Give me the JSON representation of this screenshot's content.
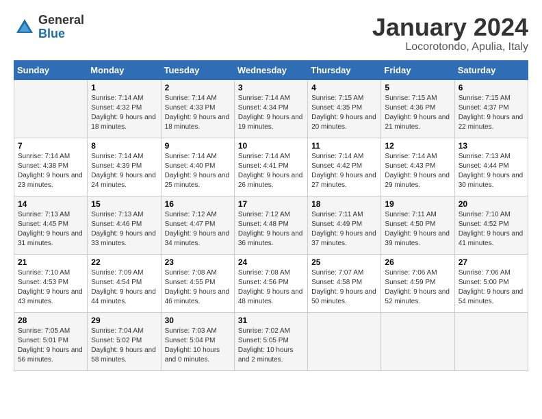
{
  "header": {
    "logo_general": "General",
    "logo_blue": "Blue",
    "month_title": "January 2024",
    "location": "Locorotondo, Apulia, Italy"
  },
  "calendar": {
    "days_of_week": [
      "Sunday",
      "Monday",
      "Tuesday",
      "Wednesday",
      "Thursday",
      "Friday",
      "Saturday"
    ],
    "weeks": [
      [
        {
          "day": "",
          "sunrise": "",
          "sunset": "",
          "daylight": ""
        },
        {
          "day": "1",
          "sunrise": "Sunrise: 7:14 AM",
          "sunset": "Sunset: 4:32 PM",
          "daylight": "Daylight: 9 hours and 18 minutes."
        },
        {
          "day": "2",
          "sunrise": "Sunrise: 7:14 AM",
          "sunset": "Sunset: 4:33 PM",
          "daylight": "Daylight: 9 hours and 18 minutes."
        },
        {
          "day": "3",
          "sunrise": "Sunrise: 7:14 AM",
          "sunset": "Sunset: 4:34 PM",
          "daylight": "Daylight: 9 hours and 19 minutes."
        },
        {
          "day": "4",
          "sunrise": "Sunrise: 7:15 AM",
          "sunset": "Sunset: 4:35 PM",
          "daylight": "Daylight: 9 hours and 20 minutes."
        },
        {
          "day": "5",
          "sunrise": "Sunrise: 7:15 AM",
          "sunset": "Sunset: 4:36 PM",
          "daylight": "Daylight: 9 hours and 21 minutes."
        },
        {
          "day": "6",
          "sunrise": "Sunrise: 7:15 AM",
          "sunset": "Sunset: 4:37 PM",
          "daylight": "Daylight: 9 hours and 22 minutes."
        }
      ],
      [
        {
          "day": "7",
          "sunrise": "Sunrise: 7:14 AM",
          "sunset": "Sunset: 4:38 PM",
          "daylight": "Daylight: 9 hours and 23 minutes."
        },
        {
          "day": "8",
          "sunrise": "Sunrise: 7:14 AM",
          "sunset": "Sunset: 4:39 PM",
          "daylight": "Daylight: 9 hours and 24 minutes."
        },
        {
          "day": "9",
          "sunrise": "Sunrise: 7:14 AM",
          "sunset": "Sunset: 4:40 PM",
          "daylight": "Daylight: 9 hours and 25 minutes."
        },
        {
          "day": "10",
          "sunrise": "Sunrise: 7:14 AM",
          "sunset": "Sunset: 4:41 PM",
          "daylight": "Daylight: 9 hours and 26 minutes."
        },
        {
          "day": "11",
          "sunrise": "Sunrise: 7:14 AM",
          "sunset": "Sunset: 4:42 PM",
          "daylight": "Daylight: 9 hours and 27 minutes."
        },
        {
          "day": "12",
          "sunrise": "Sunrise: 7:14 AM",
          "sunset": "Sunset: 4:43 PM",
          "daylight": "Daylight: 9 hours and 29 minutes."
        },
        {
          "day": "13",
          "sunrise": "Sunrise: 7:13 AM",
          "sunset": "Sunset: 4:44 PM",
          "daylight": "Daylight: 9 hours and 30 minutes."
        }
      ],
      [
        {
          "day": "14",
          "sunrise": "Sunrise: 7:13 AM",
          "sunset": "Sunset: 4:45 PM",
          "daylight": "Daylight: 9 hours and 31 minutes."
        },
        {
          "day": "15",
          "sunrise": "Sunrise: 7:13 AM",
          "sunset": "Sunset: 4:46 PM",
          "daylight": "Daylight: 9 hours and 33 minutes."
        },
        {
          "day": "16",
          "sunrise": "Sunrise: 7:12 AM",
          "sunset": "Sunset: 4:47 PM",
          "daylight": "Daylight: 9 hours and 34 minutes."
        },
        {
          "day": "17",
          "sunrise": "Sunrise: 7:12 AM",
          "sunset": "Sunset: 4:48 PM",
          "daylight": "Daylight: 9 hours and 36 minutes."
        },
        {
          "day": "18",
          "sunrise": "Sunrise: 7:11 AM",
          "sunset": "Sunset: 4:49 PM",
          "daylight": "Daylight: 9 hours and 37 minutes."
        },
        {
          "day": "19",
          "sunrise": "Sunrise: 7:11 AM",
          "sunset": "Sunset: 4:50 PM",
          "daylight": "Daylight: 9 hours and 39 minutes."
        },
        {
          "day": "20",
          "sunrise": "Sunrise: 7:10 AM",
          "sunset": "Sunset: 4:52 PM",
          "daylight": "Daylight: 9 hours and 41 minutes."
        }
      ],
      [
        {
          "day": "21",
          "sunrise": "Sunrise: 7:10 AM",
          "sunset": "Sunset: 4:53 PM",
          "daylight": "Daylight: 9 hours and 43 minutes."
        },
        {
          "day": "22",
          "sunrise": "Sunrise: 7:09 AM",
          "sunset": "Sunset: 4:54 PM",
          "daylight": "Daylight: 9 hours and 44 minutes."
        },
        {
          "day": "23",
          "sunrise": "Sunrise: 7:08 AM",
          "sunset": "Sunset: 4:55 PM",
          "daylight": "Daylight: 9 hours and 46 minutes."
        },
        {
          "day": "24",
          "sunrise": "Sunrise: 7:08 AM",
          "sunset": "Sunset: 4:56 PM",
          "daylight": "Daylight: 9 hours and 48 minutes."
        },
        {
          "day": "25",
          "sunrise": "Sunrise: 7:07 AM",
          "sunset": "Sunset: 4:58 PM",
          "daylight": "Daylight: 9 hours and 50 minutes."
        },
        {
          "day": "26",
          "sunrise": "Sunrise: 7:06 AM",
          "sunset": "Sunset: 4:59 PM",
          "daylight": "Daylight: 9 hours and 52 minutes."
        },
        {
          "day": "27",
          "sunrise": "Sunrise: 7:06 AM",
          "sunset": "Sunset: 5:00 PM",
          "daylight": "Daylight: 9 hours and 54 minutes."
        }
      ],
      [
        {
          "day": "28",
          "sunrise": "Sunrise: 7:05 AM",
          "sunset": "Sunset: 5:01 PM",
          "daylight": "Daylight: 9 hours and 56 minutes."
        },
        {
          "day": "29",
          "sunrise": "Sunrise: 7:04 AM",
          "sunset": "Sunset: 5:02 PM",
          "daylight": "Daylight: 9 hours and 58 minutes."
        },
        {
          "day": "30",
          "sunrise": "Sunrise: 7:03 AM",
          "sunset": "Sunset: 5:04 PM",
          "daylight": "Daylight: 10 hours and 0 minutes."
        },
        {
          "day": "31",
          "sunrise": "Sunrise: 7:02 AM",
          "sunset": "Sunset: 5:05 PM",
          "daylight": "Daylight: 10 hours and 2 minutes."
        },
        {
          "day": "",
          "sunrise": "",
          "sunset": "",
          "daylight": ""
        },
        {
          "day": "",
          "sunrise": "",
          "sunset": "",
          "daylight": ""
        },
        {
          "day": "",
          "sunrise": "",
          "sunset": "",
          "daylight": ""
        }
      ]
    ]
  }
}
